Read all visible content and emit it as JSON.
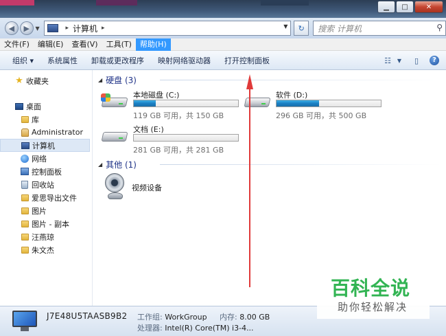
{
  "address": {
    "segments": [
      "计算机"
    ],
    "search_placeholder": "搜索 计算机"
  },
  "menu": [
    {
      "label": "文件(F)"
    },
    {
      "label": "编辑(E)"
    },
    {
      "label": "查看(V)"
    },
    {
      "label": "工具(T)"
    },
    {
      "label": "帮助(H)",
      "active": true
    }
  ],
  "toolbar": {
    "organize": "组织 ▾",
    "system_props": "系统属性",
    "uninstall": "卸载或更改程序",
    "map_drive": "映射网络驱动器",
    "control_panel": "打开控制面板"
  },
  "nav": {
    "favorites": "收藏夹",
    "desktop": "桌面",
    "library": "库",
    "administrator": "Administrator",
    "computer": "计算机",
    "network": "网络",
    "control_panel": "控制面板",
    "recycle_bin": "回收站",
    "folder1": "爱思导出文件",
    "folder2": "图片",
    "folder3": "图片 - 副本",
    "folder4": "汪燕琼",
    "folder5": "朱文杰"
  },
  "groups": {
    "hdd": "硬盘 (3)",
    "other": "其他 (1)"
  },
  "drives": [
    {
      "name": "本地磁盘 (C:)",
      "info": "119 GB 可用，共 150 GB",
      "used_fraction": 0.21
    },
    {
      "name": "软件 (D:)",
      "info": "296 GB 可用，共 500 GB",
      "used_fraction": 0.41
    },
    {
      "name": "文档 (E:)",
      "info": "281 GB 可用，共 281 GB",
      "used_fraction": 0.0
    }
  ],
  "other_device": "视频设备",
  "details": {
    "computer_name": "J7E48U5TAASB9B2",
    "workgroup_label": "工作组:",
    "workgroup_value": "WorkGroup",
    "memory_label": "内存:",
    "memory_value": "8.00 GB",
    "processor_label": "处理器:",
    "processor_value": "Intel(R) Core(TM) i3-4..."
  },
  "watermark": {
    "title": "百科全说",
    "subtitle": "助你轻松解决"
  },
  "colors": {
    "accent": "#3399ff",
    "group_heading": "#1e3287",
    "arrow": "#e03a3a",
    "watermark_green": "#28b04a"
  }
}
